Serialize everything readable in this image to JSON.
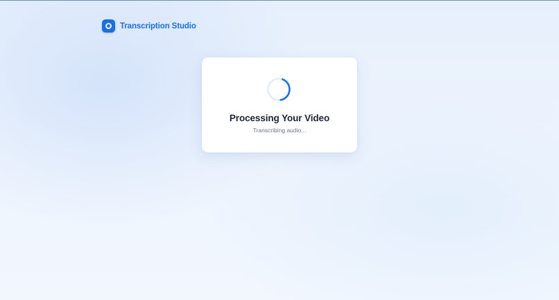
{
  "app": {
    "name": "Transcription Studio",
    "logo_icon": "record-icon",
    "accent_color": "#1a6fe8"
  },
  "processing": {
    "title": "Processing Your Video",
    "status": "Transcribing audio...",
    "spinner_icon": "loading-spinner-icon"
  }
}
